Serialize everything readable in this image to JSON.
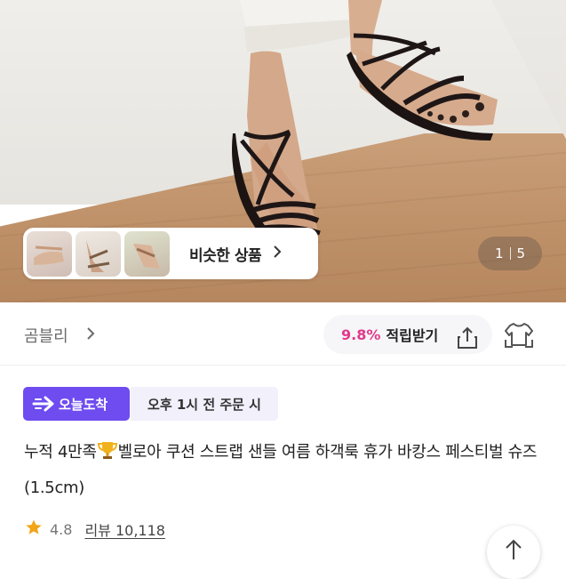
{
  "gallery": {
    "similar_label": "비슷한 상품",
    "current_page": "1",
    "total_pages": "5"
  },
  "store": {
    "name": "곰블리",
    "points_percent": "9.8%",
    "points_label": "적립받기"
  },
  "delivery": {
    "badge_label": "오늘도착",
    "cutoff_text": "오후 1시 전 주문 시"
  },
  "product": {
    "title_prefix": "누적 4만족",
    "title_rest": "벨로아 쿠션 스트랩 샌들 여름 하객룩 휴가 바캉스 페스티벌 슈즈 (1.5cm)",
    "rating": "4.8",
    "review_text": "리뷰 10,118"
  },
  "colors": {
    "accent_pink": "#e23a8a",
    "delivery_purple": "#6e4cf0",
    "star_gold": "#f2a516"
  },
  "icons": [
    "chevron-right-icon",
    "share-icon",
    "fitting-shirt-icon",
    "delivery-arrow-icon",
    "trophy-icon",
    "star-icon",
    "arrow-up-icon"
  ]
}
